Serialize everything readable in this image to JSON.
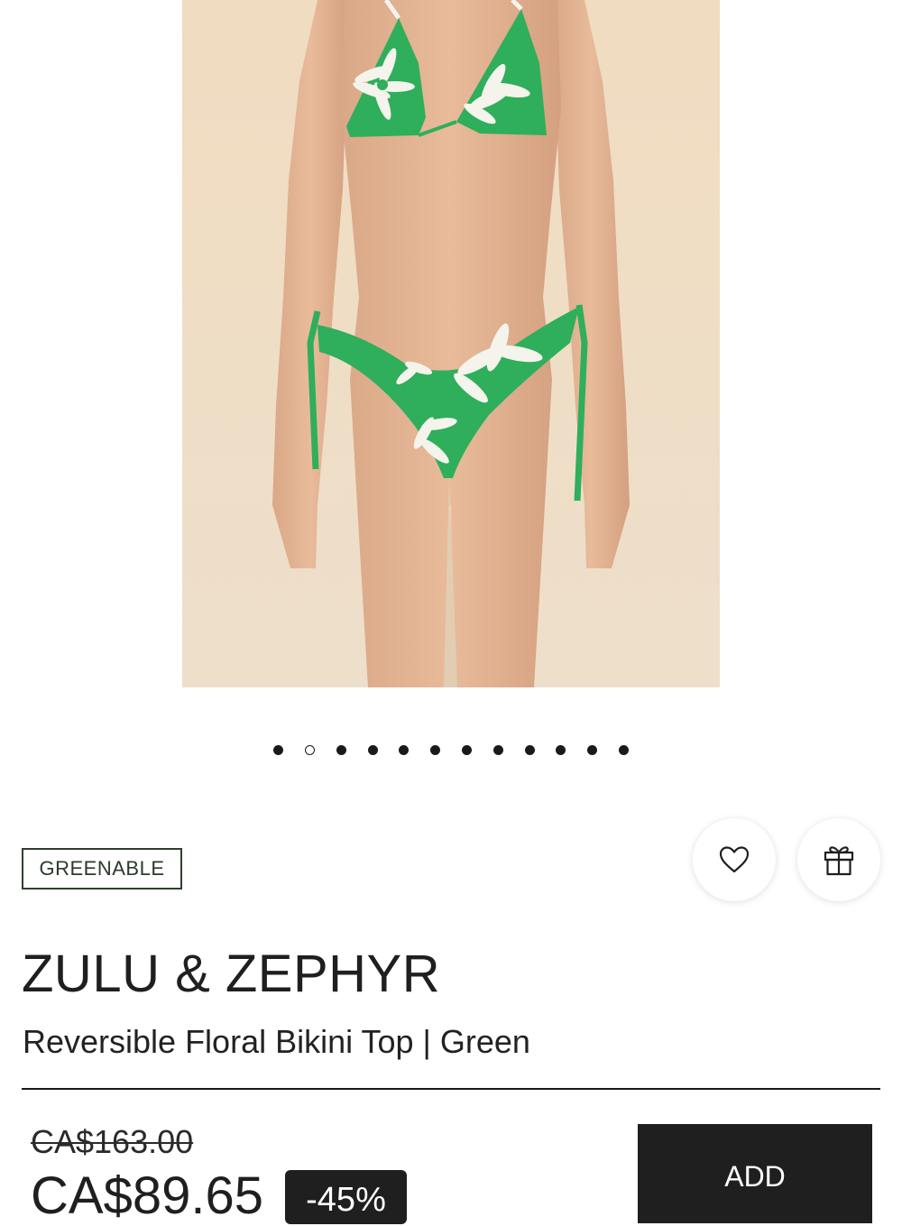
{
  "carousel": {
    "dot_count": 12,
    "active_index": 1
  },
  "badge": {
    "label": "GREENABLE"
  },
  "actions": {
    "wishlist_icon": "heart-icon",
    "gift_icon": "gift-icon"
  },
  "product": {
    "brand": "ZULU & ZEPHYR",
    "name": "Reversible Floral Bikini Top | Green",
    "original_price": "CA$163.00",
    "sale_price": "CA$89.65",
    "discount": "-45%"
  },
  "cart": {
    "add_label": "ADD"
  },
  "colors": {
    "swimsuit_green": "#2fae5c",
    "background_beige": "#eedcc2",
    "dark": "#1f1f1f"
  }
}
